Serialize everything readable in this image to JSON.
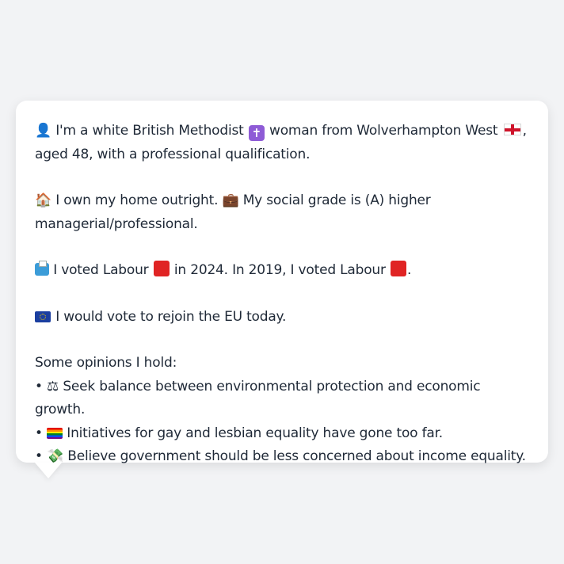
{
  "bubble": {
    "line1": {
      "icon": "person-icon",
      "before_religion_icon": "I'm a white British Methodist",
      "after_religion_icon": "woman from Wolverhampton West",
      "after_flag": ",",
      "line2": "aged 48, with a professional qualification."
    },
    "home": {
      "icon": "house-icon",
      "text1": "I own my home outright.",
      "icon2": "briefcase-icon",
      "text2": "My social grade is (A) higher",
      "text3": "managerial/professional."
    },
    "vote": {
      "icon": "ballot-box-icon",
      "text1": "I voted Labour",
      "text2": "in 2024. In 2019, I voted Labour",
      "text3": "."
    },
    "eu": {
      "icon": "eu-flag-icon",
      "text": "I would vote to rejoin the EU today."
    },
    "opinions": {
      "heading": "Some opinions I hold:",
      "items": [
        {
          "bullet": "•",
          "icon": "scales-icon",
          "text": "Seek balance between environmental protection and economic growth."
        },
        {
          "bullet": "•",
          "icon": "rainbow-flag-icon",
          "text": "Initiatives for gay and lesbian equality have gone too far."
        },
        {
          "bullet": "•",
          "icon": "money-icon",
          "text": "Believe government should be less concerned about income equality."
        }
      ]
    }
  },
  "colors": {
    "background": "#f2f3f5",
    "card": "#ffffff",
    "text": "#1f2937",
    "labour_red": "#e02424",
    "cross_purple": "#8e5bd6"
  }
}
